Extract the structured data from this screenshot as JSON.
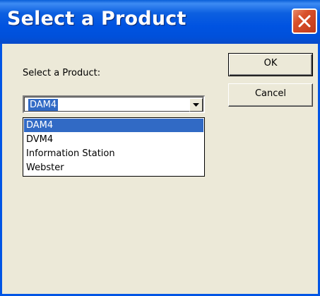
{
  "window": {
    "title": "Select a Product",
    "close_icon": "close-x-icon"
  },
  "form": {
    "label": "Select a Product:",
    "selected_value": "DAM4",
    "dropdown_icon": "chevron-down-icon"
  },
  "options": [
    {
      "label": "DAM4",
      "selected": true
    },
    {
      "label": "DVM4",
      "selected": false
    },
    {
      "label": "Information Station",
      "selected": false
    },
    {
      "label": "Webster",
      "selected": false
    }
  ],
  "buttons": {
    "ok_label": "OK",
    "cancel_label": "Cancel"
  },
  "colors": {
    "titlebar": "#0055e5",
    "selection": "#316ac5",
    "dialog_bg": "#ece9d8",
    "close_button": "#d9502a"
  }
}
